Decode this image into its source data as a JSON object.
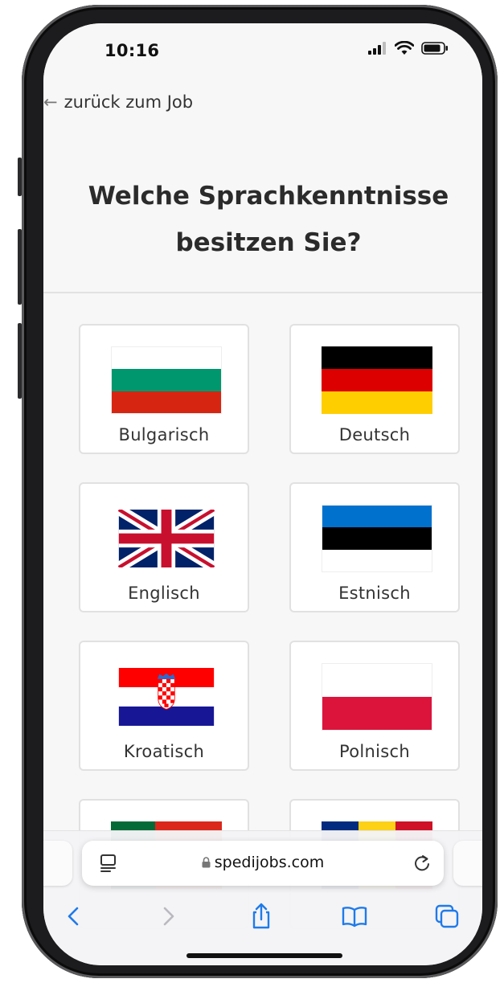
{
  "status_bar": {
    "time": "10:16"
  },
  "page": {
    "back_link": "zurück zum Job",
    "headline_line1": "Welche Sprachkenntnisse",
    "headline_line2": "besitzen Sie?",
    "languages": [
      {
        "label": "Bulgarisch",
        "flag": "bulgaria-flag-icon"
      },
      {
        "label": "Deutsch",
        "flag": "germany-flag-icon"
      },
      {
        "label": "Englisch",
        "flag": "uk-flag-icon"
      },
      {
        "label": "Estnisch",
        "flag": "estonia-flag-icon"
      },
      {
        "label": "Kroatisch",
        "flag": "croatia-flag-icon"
      },
      {
        "label": "Polnisch",
        "flag": "poland-flag-icon"
      },
      {
        "label": "",
        "flag": "portugal-flag-icon"
      },
      {
        "label": "",
        "flag": "romania-flag-icon"
      }
    ]
  },
  "browser": {
    "url": "spedijobs.com",
    "accent_color": "#1f7aea"
  }
}
